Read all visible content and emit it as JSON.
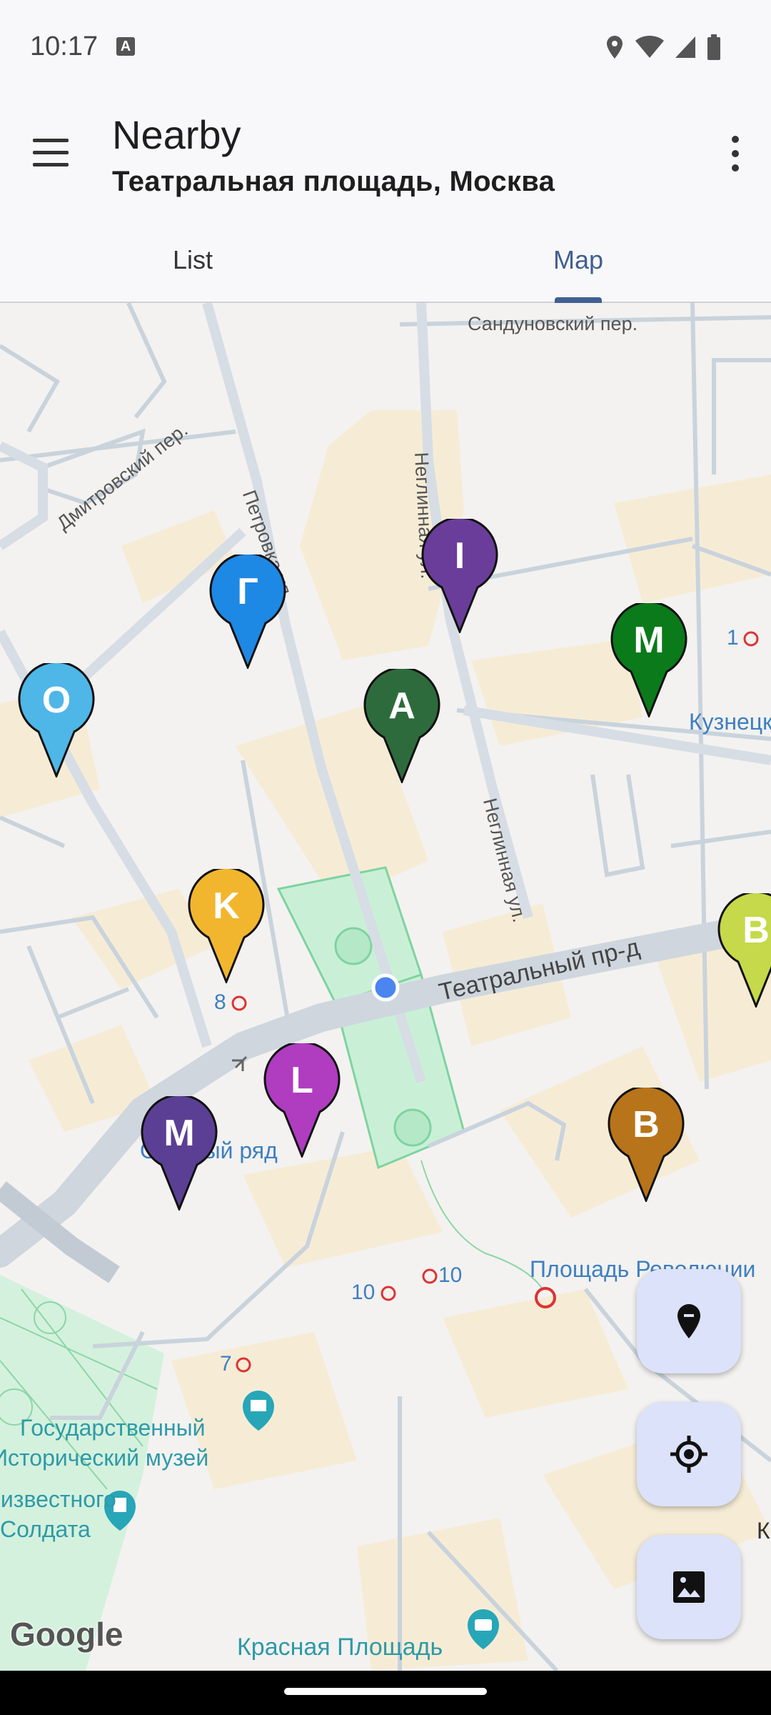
{
  "status_bar": {
    "time": "10:17",
    "notification_icon": "a-letter-icon",
    "icons": [
      "location-icon",
      "wifi-icon",
      "signal-icon",
      "battery-icon"
    ]
  },
  "app_bar": {
    "title": "Nearby",
    "subtitle": "Театральная площадь, Москва"
  },
  "tabs": [
    {
      "label": "List",
      "selected": false
    },
    {
      "label": "Map",
      "selected": true
    }
  ],
  "map": {
    "street_labels": {
      "sandunovsky": "Сандуновский пер.",
      "dmitrovsky": "Дмитровский пер.",
      "petrovka": "Петровка ул.",
      "neglinnaya_top": "Неглинная ул.",
      "neglinnaya_mid": "Неглинная ул.",
      "teatralny": "Театральный пр-д",
      "kuznetsky": "Кузнецк",
      "okhotny": "Охотный ряд",
      "ploshchad_rev": "Площадь Революции",
      "gos_museum_1": "Государственный",
      "gos_museum_2": "Исторический музей",
      "soldier_1": "Неизвестного",
      "soldier_2": "Солдата",
      "red_square": "Красная Площадь",
      "k_edge": "К"
    },
    "metro_labels": {
      "m1": "1",
      "m8": "8",
      "m10a": "10",
      "m10b": "10",
      "m7": "7"
    },
    "attribution": "Google",
    "pins": [
      {
        "letter": "Г",
        "color": "#1e88e5"
      },
      {
        "letter": "I",
        "color": "#6a3d9a"
      },
      {
        "letter": "M",
        "color": "#0b7a1a"
      },
      {
        "letter": "O",
        "color": "#4fb6e8"
      },
      {
        "letter": "A",
        "color": "#2e6b3c"
      },
      {
        "letter": "K",
        "color": "#f2b62e"
      },
      {
        "letter": "B",
        "color": "#c6d94a"
      },
      {
        "letter": "L",
        "color": "#b03cc0"
      },
      {
        "letter": "M",
        "color": "#5b3f94"
      },
      {
        "letter": "B",
        "color": "#b8741a"
      }
    ]
  },
  "fabs": [
    "pin-icon",
    "my-location-icon",
    "image-icon"
  ]
}
